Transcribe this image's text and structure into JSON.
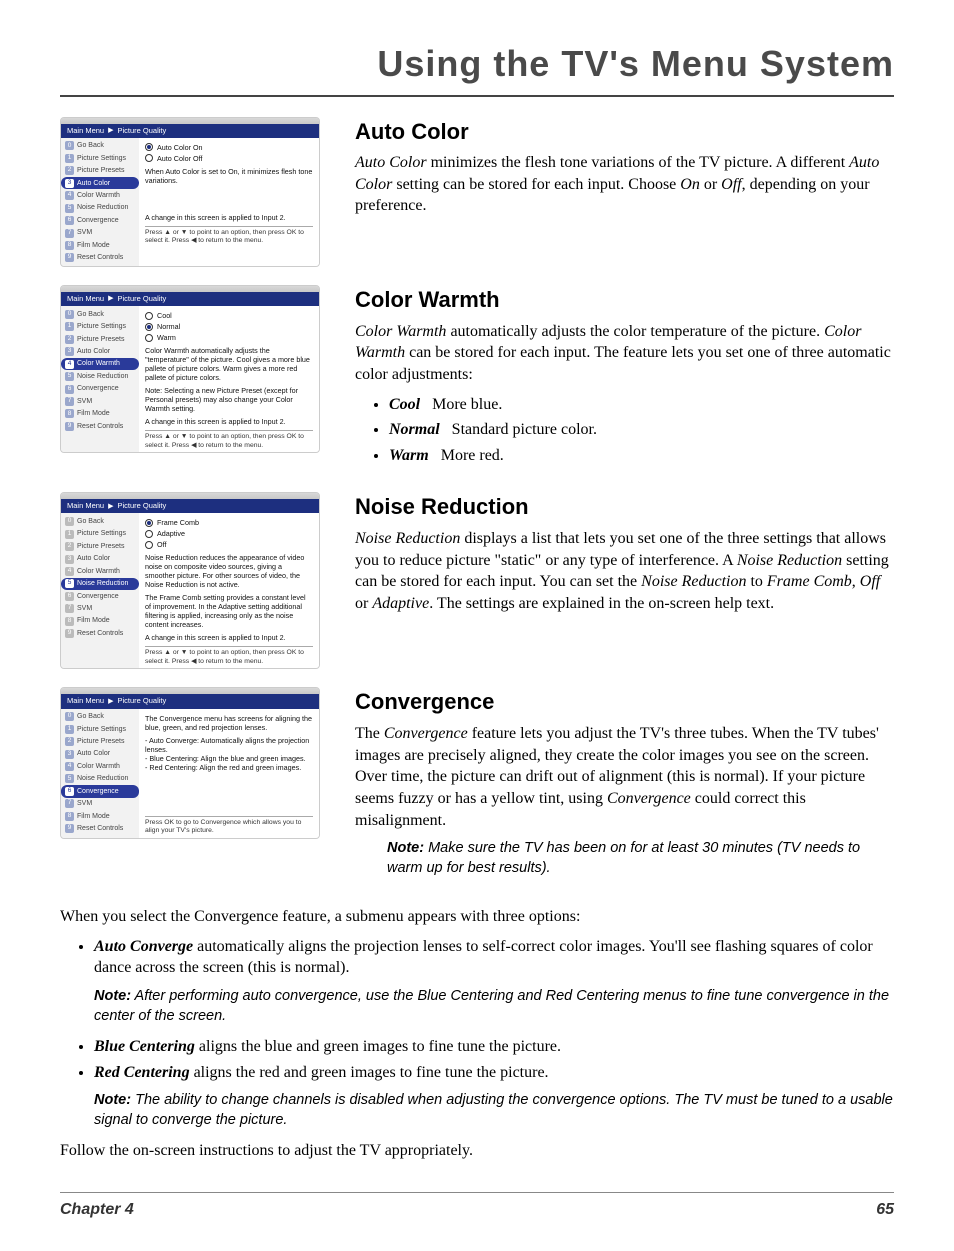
{
  "header": {
    "title": "Using the TV's Menu System"
  },
  "footer": {
    "chapter": "Chapter 4",
    "page": "65"
  },
  "common": {
    "sidebar_items": [
      "Go Back",
      "Picture Settings",
      "Picture Presets",
      "Auto Color",
      "Color Warmth",
      "Noise Reduction",
      "Convergence",
      "SVM",
      "Film Mode",
      "Reset Controls"
    ],
    "help_nav": "Press ▲ or ▼ to point to an option, then press OK to select it. Press ◀ to return to the menu.",
    "help_ok": "Press OK to go to Convergence which allows you to align your TV's picture."
  },
  "sections": {
    "auto_color": {
      "heading": "Auto Color",
      "breadcrumb_a": "Main Menu",
      "breadcrumb_b": "Picture Quality",
      "opts": [
        "Auto Color On",
        "Auto Color Off"
      ],
      "desc": "When Auto Color is set to On, it minimizes flesh tone variations.",
      "applied": "A change in this screen is applied to Input 2.",
      "body_prefix": "Auto Color",
      "body_rest": " minimizes the flesh tone variations of the TV picture. A different ",
      "body_mid": "Auto Color",
      "body_rest2": " setting can be stored for each input. Choose ",
      "on": "On",
      "or": " or ",
      "off": "Off",
      "body_tail": ", depending on your preference."
    },
    "color_warmth": {
      "heading": "Color Warmth",
      "breadcrumb_a": "Main Menu",
      "breadcrumb_b": "Picture Quality",
      "opts": [
        "Cool",
        "Normal",
        "Warm"
      ],
      "desc1": "Color Warmth automatically adjusts the \"temperature\" of the picture. Cool gives a more blue pallete of picture colors. Warm gives a more red pallete of picture colors.",
      "desc2": "Note: Selecting a new Picture Preset (except for Personal presets) may also change your Color Warmth setting.",
      "applied": "A change in this screen is applied to Input 2.",
      "body_prefix": "Color Warmth",
      "body_rest": " automatically adjusts the color temperature of the picture. ",
      "body_mid": "Color Warmth",
      "body_rest2": " can be stored for each input. The feature lets you set one of three automatic color adjustments:",
      "items": [
        {
          "term": "Cool",
          "desc": "More blue."
        },
        {
          "term": "Normal",
          "desc": "Standard picture color."
        },
        {
          "term": "Warm",
          "desc": "More red."
        }
      ]
    },
    "noise": {
      "heading": "Noise Reduction",
      "breadcrumb_a": "Main Menu",
      "breadcrumb_b": "Picture Quality",
      "opts": [
        "Frame Comb",
        "Adaptive",
        "Off"
      ],
      "desc1": "Noise Reduction reduces the appearance of video noise on composite video sources, giving a smoother picture. For other sources of video, the Noise Reduction is not active.",
      "desc2": "The Frame Comb setting provides a constant level of improvement. In the Adaptive setting additional filtering is applied, increasing only as the noise content increases.",
      "applied": "A change in this screen is applied to Input 2.",
      "body_prefix": "Noise Reduction",
      "body_rest": " displays a list that lets you set one of the three settings that allows you to reduce picture \"static\" or any type of interference. A ",
      "body_mid": "Noise Reduction",
      "body_rest2": " setting can be stored for each input. You can set the ",
      "body_mid2": "Noise Reduction",
      "body_rest3": " to ",
      "fc": "Frame Comb",
      "c1": ", ",
      "off": "Off",
      "or": " or ",
      "ad": "Adaptive",
      "body_tail": ". The settings are explained in the on-screen help text."
    },
    "convergence": {
      "heading": "Convergence",
      "breadcrumb_a": "Main Menu",
      "breadcrumb_b": "Picture Quality",
      "desc1": "The Convergence menu has screens for aligning the blue, green, and red projection lenses.",
      "desc_l1": "- Auto Converge: Automatically aligns the projection lenses.",
      "desc_l2": "- Blue Centering: Align the blue and green images.",
      "desc_l3": "- Red Centering: Align the red and green images.",
      "body_t1a": "The ",
      "body_t1b": "Convergence",
      "body_t1c": " feature lets you adjust the TV's three tubes. When the TV tubes' images are precisely aligned, they create the color images you see on the screen. Over time, the picture can drift out of alignment (this is normal). If your picture seems fuzzy or has a yellow tint, using ",
      "body_t1d": "Convergence",
      "body_t1e": " could correct this misalignment.",
      "note1_label": "Note:",
      "note1_text": " Make sure the TV has been on for at least 30 minutes (TV needs to warm up for best results).",
      "sub_intro": "When you select the Convergence feature, a submenu appears with three options:",
      "items": [
        {
          "term": "Auto Converge",
          "desc": " automatically aligns the projection lenses to self-correct color images. You'll see flashing squares of color dance across the screen (this is normal)."
        },
        {
          "term": "Blue Centering",
          "desc": " aligns the blue and green images to fine tune the picture."
        },
        {
          "term": "Red Centering",
          "desc": " aligns the red and green images to fine tune the picture."
        }
      ],
      "note2_label": "Note:",
      "note2_text": " After performing auto convergence, use the Blue Centering and Red Centering menus to fine tune convergence in the center of the screen.",
      "note3_label": "Note:",
      "note3_text": " The ability to change channels is disabled when adjusting the convergence options. The TV must be tuned to a usable signal to converge the picture.",
      "closing": "Follow the on-screen instructions to adjust the TV appropriately."
    }
  }
}
